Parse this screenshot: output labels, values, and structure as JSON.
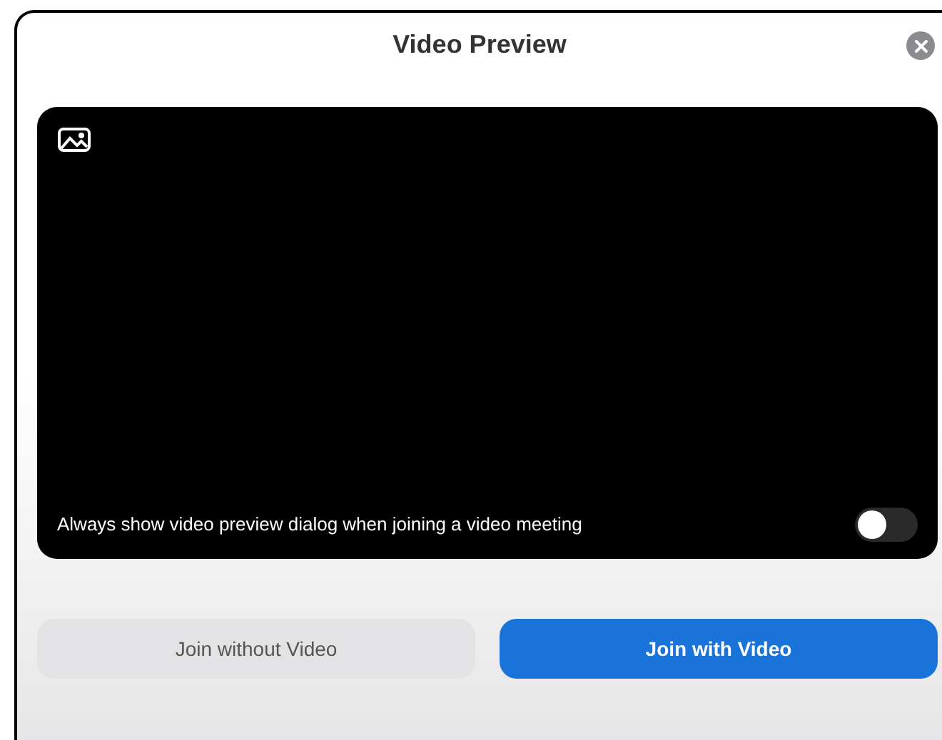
{
  "dialog": {
    "title": "Video Preview"
  },
  "preview": {
    "option": {
      "label": "Always show video preview dialog when joining a video meeting",
      "on": false
    }
  },
  "buttons": [
    {
      "label": "Join without Video",
      "kind": "secondary"
    },
    {
      "label": "Join with Video",
      "kind": "primary"
    }
  ]
}
